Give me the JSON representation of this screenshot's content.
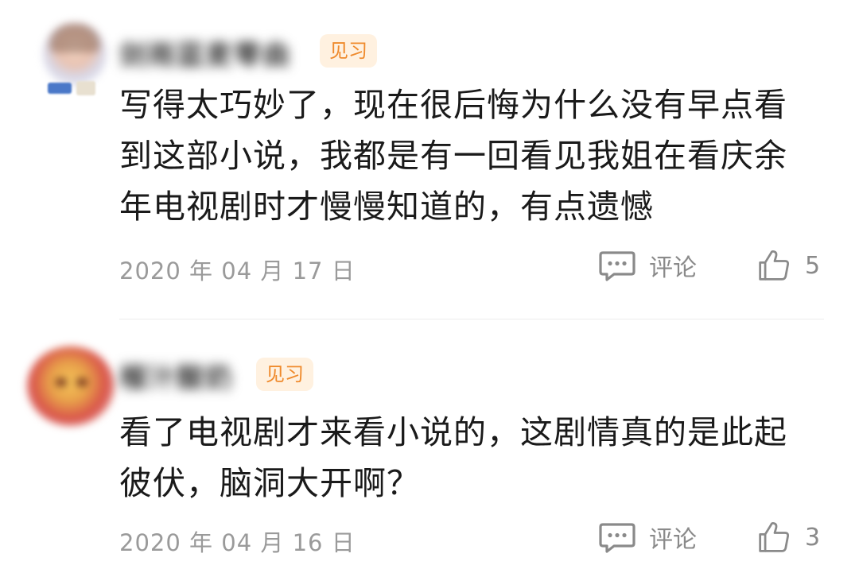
{
  "comments": [
    {
      "username": "剑雨蓝麦零曲",
      "badge": "见习",
      "text": "写得太巧妙了，现在很后悔为什么没有早点看到这部小说，我都是有一回看见我姐在看庆余年电视剧时才慢慢知道的，有点遗憾",
      "date": "2020 年 04 月 17 日",
      "comment_label": "评论",
      "likes": "5"
    },
    {
      "username": "榴汁酸奶",
      "badge": "见习",
      "text": "看了电视剧才来看小说的，这剧情真的是此起彼伏，脑洞大开啊？",
      "date": "2020 年 04 月 16 日",
      "comment_label": "评论",
      "likes": "3"
    }
  ],
  "icons": {
    "comment": "comment-bubble-icon",
    "like": "thumbs-up-icon"
  },
  "colors": {
    "badge_bg": "#fff1e0",
    "badge_text": "#ef8a2c",
    "date_text": "#9a9a9a",
    "body_text": "#1a1a1a"
  }
}
